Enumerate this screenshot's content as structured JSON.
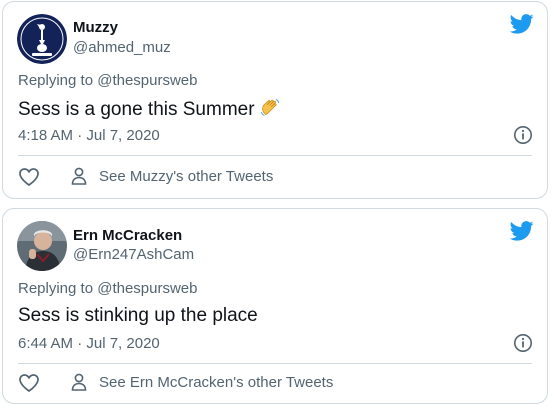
{
  "tweets": [
    {
      "display_name": "Muzzy",
      "handle": "@ahmed_muz",
      "replying_prefix": "Replying to",
      "replying_to": "@thespursweb",
      "text": "Sess is a gone this Summer",
      "emoji_icon": "waving-hand-icon",
      "timestamp": "4:18 AM · Jul 7, 2020",
      "see_other": "See Muzzy's other Tweets"
    },
    {
      "display_name": "Ern McCracken",
      "handle": "@Ern247AshCam",
      "replying_prefix": "Replying to",
      "replying_to": "@thespursweb",
      "text": "Sess is stinking up the place",
      "timestamp": "6:44 AM · Jul 7, 2020",
      "see_other": "See Ern McCracken's other Tweets"
    }
  ],
  "colors": {
    "twitter_blue": "#1d9bf0",
    "secondary_text": "#536471",
    "primary_text": "#0f1419",
    "border": "#cfd9de",
    "spurs_navy": "#132257"
  }
}
